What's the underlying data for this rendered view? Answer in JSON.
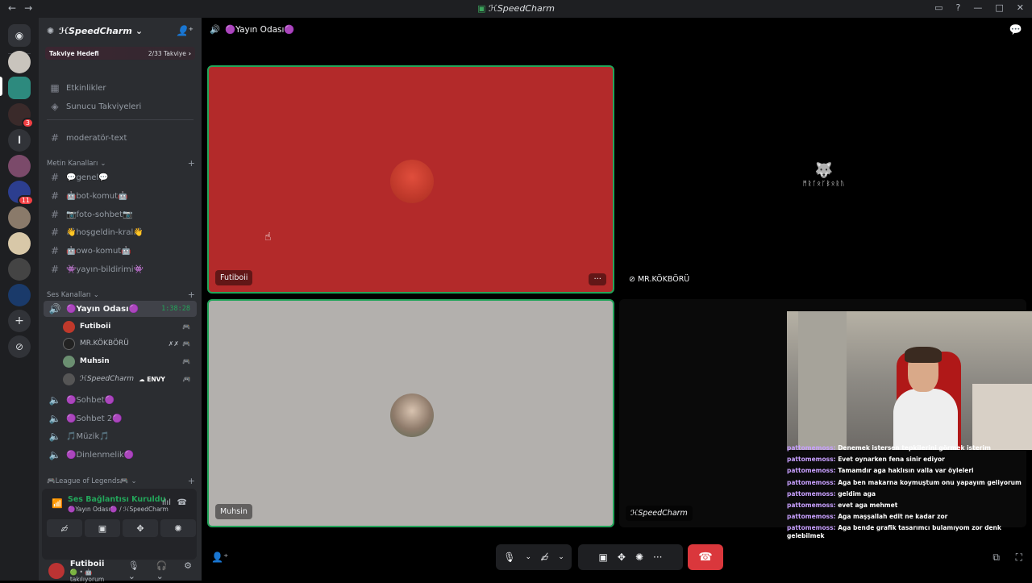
{
  "window": {
    "title": "ℋSpeedCharm"
  },
  "server": {
    "name": "ℋSpeedCharm"
  },
  "boost": {
    "label": "Takviye Hedefi",
    "progress": "2/33 Takviye"
  },
  "top_items": [
    {
      "label": "Etkinlikler"
    },
    {
      "label": "Sunucu Takviyeleri"
    }
  ],
  "mod_channel": {
    "label": "moderatör-text"
  },
  "text_category": {
    "label": "Metin Kanalları"
  },
  "text_channels": [
    {
      "label": "💬genel💬"
    },
    {
      "label": "🤖bot-komut🤖"
    },
    {
      "label": "📷foto-sohbet📷"
    },
    {
      "label": "👋hoşgeldin-kral👋"
    },
    {
      "label": "🤖owo-komut🤖"
    },
    {
      "label": "👾yayın-bildirimi👾"
    }
  ],
  "voice_category": {
    "label": "Ses Kanalları"
  },
  "active_voice": {
    "label": "🟣Yayın Odası🟣",
    "timer": "1:38:28"
  },
  "voice_members": [
    {
      "name": "Futiboii",
      "color": "#c0392b"
    },
    {
      "name": "MR.KÖKBÖRÜ",
      "color": "#222"
    },
    {
      "name": "Muhsin",
      "color": "#6b8f71"
    },
    {
      "name": "ℋSpeedCharm",
      "tag": "ENVY",
      "color": "#555"
    }
  ],
  "voice_channels": [
    {
      "label": "🟣Sohbet🟣"
    },
    {
      "label": "🟣Sohbet 2🟣"
    },
    {
      "label": "🎵Müzik🎵"
    },
    {
      "label": "🟣Dinlenmelik🟣"
    }
  ],
  "lol_category": {
    "label": "🎮League of Legends🎮"
  },
  "voice_panel": {
    "status": "Ses Bağlantısı Kuruldu",
    "sub": "🟣Yayın Odası🟣 / ℋSpeedCharm"
  },
  "user": {
    "name": "Futiboii",
    "status": "🟢 • 🤖 takılıyorum"
  },
  "channel_header": {
    "label": "🟣Yayın Odası🟣"
  },
  "tiles": [
    {
      "name": "Futiboii",
      "bg": "#b32a2a"
    },
    {
      "name": "MR.KÖKBÖRÜ",
      "bg": "#000000",
      "logo_text": "ᛗᚱᚴᛟᚴᛒᛟᚱᚢ"
    },
    {
      "name": "Muhsin",
      "bg": "#b3b0ad"
    },
    {
      "name": "ℋSpeedCharm",
      "bg": "#000000"
    }
  ],
  "guild_badges": [
    "3",
    "11"
  ],
  "guild_letter": "l",
  "chat_messages": [
    {
      "user": "pattomemoss:",
      "text": "Denemek istersen tepkilerini görmek isterim"
    },
    {
      "user": "pattomemoss:",
      "text": "Evet oynarken fena sinir ediyor"
    },
    {
      "user": "pattomemoss:",
      "text": "Tamamdır aga haklısın valla var öyleleri"
    },
    {
      "user": "pattomemoss:",
      "text": "Aga ben makarna koymuştum onu yapayım geliyorum"
    },
    {
      "user": "pattomemoss:",
      "text": "geldim aga"
    },
    {
      "user": "pattomemoss:",
      "text": "evet aga mehmet"
    },
    {
      "user": "pattomemoss:",
      "text": "Aga maşşallah edit ne kadar zor"
    },
    {
      "user": "pattomemoss:",
      "text": "Aga bende grafik tasarımcı bulamıyom zor denk gelebilmek"
    }
  ]
}
